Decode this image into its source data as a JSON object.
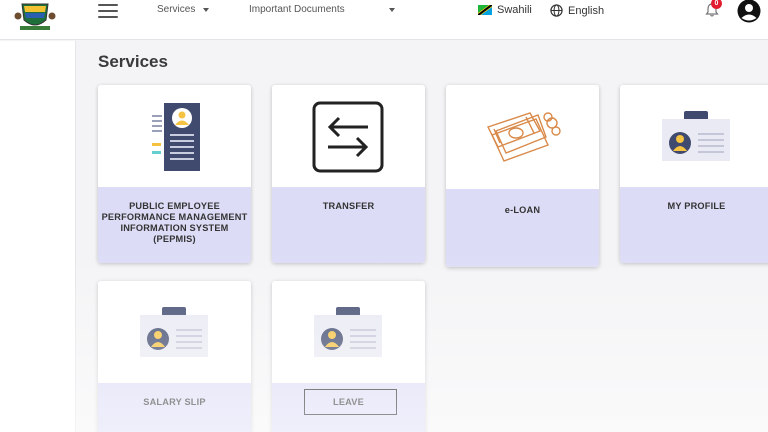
{
  "header": {
    "services_label": "Services",
    "documents_label": "Important Documents",
    "swahili_label": "Swahili",
    "english_label": "English",
    "notification_count": "0"
  },
  "main": {
    "title": "Services",
    "cards": [
      {
        "label": "PUBLIC EMPLOYEE PERFORMANCE MANAGEMENT INFORMATION SYSTEM (PEPMIS)",
        "icon": "document-profile-icon"
      },
      {
        "label": "TRANSFER",
        "icon": "transfer-arrows-icon"
      },
      {
        "label": "e-LOAN",
        "icon": "money-icon"
      },
      {
        "label": "MY PROFILE",
        "icon": "id-badge-icon"
      },
      {
        "label": "SALARY SLIP",
        "icon": "id-badge-icon"
      },
      {
        "label": "LEAVE",
        "icon": "id-badge-icon"
      }
    ]
  },
  "colors": {
    "card_footer": "#dcdcf7",
    "badge": "#e11d2e",
    "icon_navy": "#3f4a6e",
    "icon_yellow": "#f5c242"
  }
}
